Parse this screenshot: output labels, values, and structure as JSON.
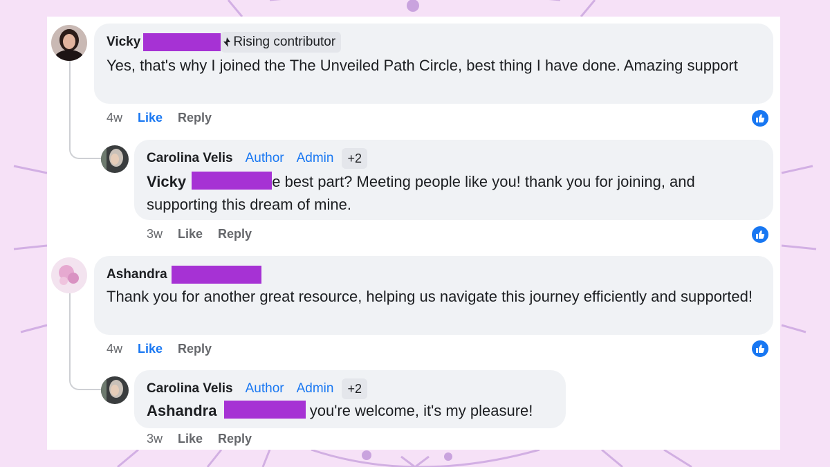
{
  "comments": [
    {
      "name": "Vicky",
      "badge": "Rising contributor",
      "text": "Yes, that's why I joined the The Unveiled Path Circle, best thing I have done. Amazing support",
      "time": "4w",
      "like": "Like",
      "reply": "Reply"
    },
    {
      "name": "Carolina Velis",
      "role1": "Author",
      "role2": "Admin",
      "extra": "+2",
      "mention": "Vicky",
      "text": "e best part? Meeting people like you! thank you for joining, and supporting this dream of mine.",
      "time": "3w",
      "like": "Like",
      "reply": "Reply"
    },
    {
      "name": "Ashandra",
      "text": "Thank you for another great resource, helping us navigate this journey efficiently and supported!",
      "time": "4w",
      "like": "Like",
      "reply": "Reply"
    },
    {
      "name": "Carolina Velis",
      "role1": "Author",
      "role2": "Admin",
      "extra": "+2",
      "mention": "Ashandra",
      "text": "you're welcome, it's my pleasure!",
      "time": "3w",
      "like": "Like",
      "reply": "Reply"
    }
  ],
  "colors": {
    "accent": "#1877f2",
    "redaction": "#a632d4",
    "background": "#f6e1f7"
  },
  "icons": {
    "reaction": "thumbs-up-icon",
    "badge": "rising-contributor-icon"
  }
}
